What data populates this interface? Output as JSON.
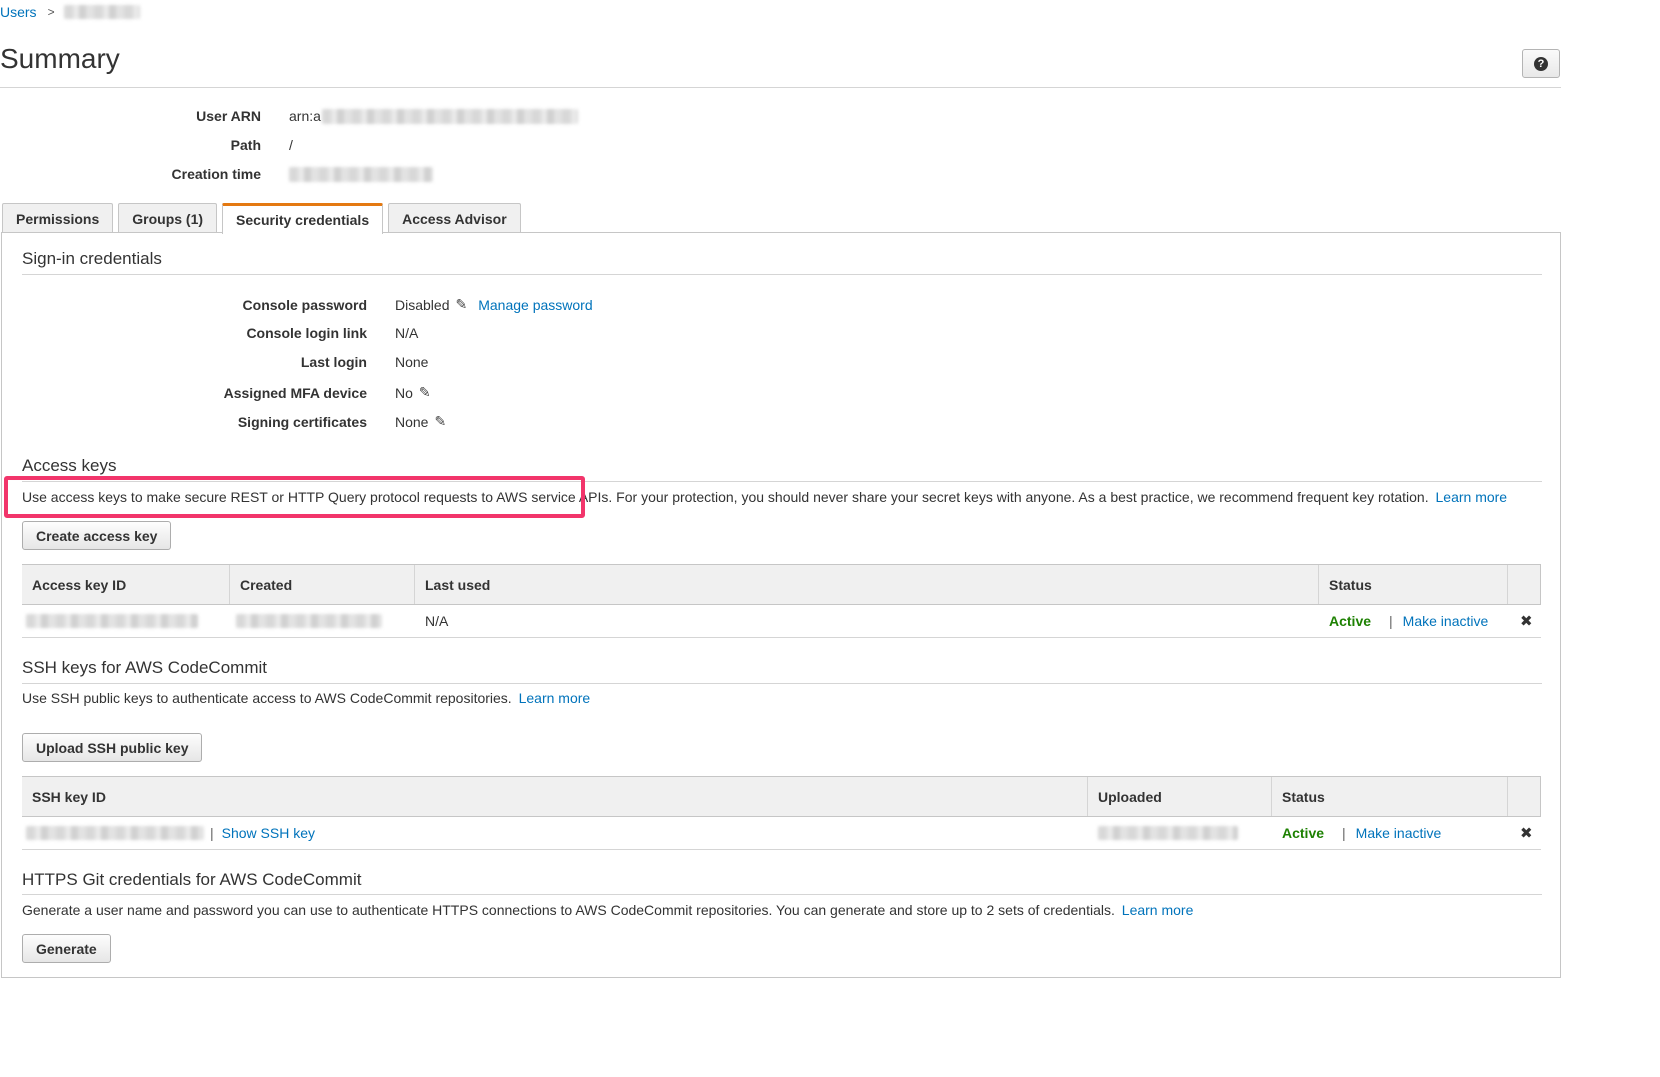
{
  "breadcrumb": {
    "root": "Users",
    "separator": ">"
  },
  "page": {
    "title": "Summary",
    "help_icon": "question-circle-icon",
    "help_glyph": "?"
  },
  "summary": [
    {
      "label": "User ARN",
      "value": "arn:a"
    },
    {
      "label": "Path",
      "value": "/"
    },
    {
      "label": "Creation time",
      "value": ""
    }
  ],
  "tabs": [
    {
      "label": "Permissions",
      "active": false
    },
    {
      "label": "Groups (1)",
      "active": false
    },
    {
      "label": "Security credentials",
      "active": true
    },
    {
      "label": "Access Advisor",
      "active": false
    }
  ],
  "signin": {
    "title": "Sign-in credentials",
    "rows": [
      {
        "label": "Console password",
        "value": "Disabled",
        "editable": true,
        "link": "Manage password"
      },
      {
        "label": "Console login link",
        "value": "N/A"
      },
      {
        "label": "Last login",
        "value": "None"
      },
      {
        "label": "Assigned MFA device",
        "value": "No",
        "editable": true
      },
      {
        "label": "Signing certificates",
        "value": "None",
        "editable": true
      }
    ]
  },
  "access_keys": {
    "title": "Access keys",
    "description_highlighted": "Use access keys to make secure REST or HTTP Query protocol requests to AWS service APIs.",
    "description_rest": " For your protection, you should never share your secret keys with anyone. As a best practice, we recommend frequent key rotation.",
    "learn_more": "Learn more",
    "create_button": "Create access key",
    "columns": [
      "Access key ID",
      "Created",
      "Last used",
      "Status",
      ""
    ],
    "row": {
      "last_used": "N/A",
      "status": "Active",
      "action": "Make inactive",
      "separator": "|",
      "delete_icon": "close-icon",
      "delete_glyph": "✖"
    }
  },
  "ssh_keys": {
    "title": "SSH keys for AWS CodeCommit",
    "description": "Use SSH public keys to authenticate access to AWS CodeCommit repositories.",
    "learn_more": "Learn more",
    "upload_button": "Upload SSH public key",
    "columns": [
      "SSH key ID",
      "Uploaded",
      "Status",
      ""
    ],
    "row": {
      "show_link": "Show SSH key",
      "status": "Active",
      "action": "Make inactive",
      "separator": "|",
      "delete_icon": "close-icon",
      "delete_glyph": "✖"
    }
  },
  "https_git": {
    "title": "HTTPS Git credentials for AWS CodeCommit",
    "description": "Generate a user name and password you can use to authenticate HTTPS connections to AWS CodeCommit repositories. You can generate and store up to 2 sets of credentials.",
    "learn_more": "Learn more",
    "generate_button": "Generate"
  },
  "colors": {
    "link": "#0073bb",
    "active_status": "#1d8102",
    "tab_accent": "#e47911",
    "highlight": "#f2356b"
  }
}
